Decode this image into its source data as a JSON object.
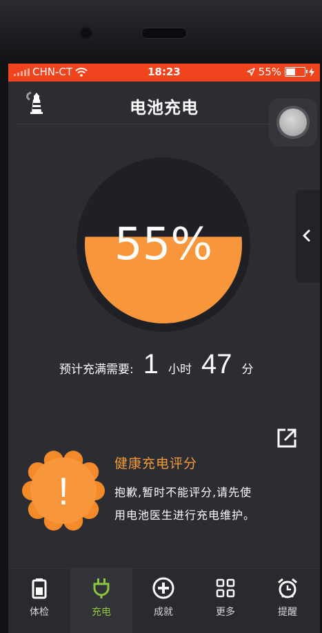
{
  "status_bar": {
    "carrier": "CHN-CT",
    "time": "18:23",
    "battery_text": "55%",
    "battery_level": 0.55,
    "color": "#f0441f"
  },
  "header": {
    "title": "电池充电",
    "left_icon": "lighthouse-icon",
    "float_icon": "assistive-ball-icon"
  },
  "charge": {
    "percent_text": "55%",
    "level": 0.55,
    "eta_label": "预计充满需要:",
    "hours": "1",
    "hours_unit": "小时",
    "minutes": "47",
    "minutes_unit": "分",
    "accent": "#f7963a"
  },
  "health": {
    "title": "健康充电评分",
    "desc_line1": "抱歉,暂时不能评分,请先使",
    "desc_line2": "用电池医生进行充电维护。",
    "badge_symbol": "!",
    "title_color": "#f39a3a"
  },
  "nav": {
    "items": [
      {
        "label": "体检",
        "icon": "battery-check-icon",
        "active": false
      },
      {
        "label": "充电",
        "icon": "plug-icon",
        "active": true
      },
      {
        "label": "成就",
        "icon": "plus-circle-icon",
        "active": false
      },
      {
        "label": "更多",
        "icon": "grid-icon",
        "active": false
      },
      {
        "label": "提醒",
        "icon": "alarm-clock-icon",
        "active": false
      }
    ],
    "active_color": "#8ec63f"
  }
}
